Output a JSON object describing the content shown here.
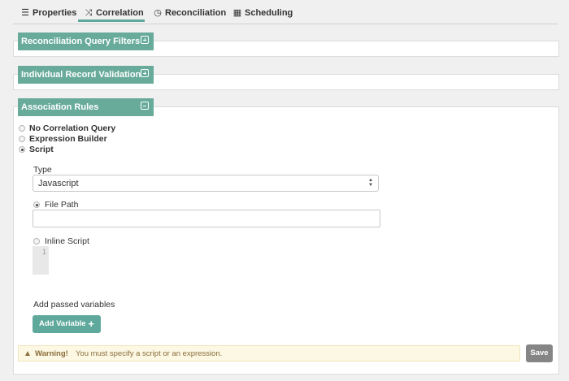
{
  "tabs": [
    {
      "label": "Properties",
      "icon": "list-icon",
      "glyph": "☰",
      "active": false
    },
    {
      "label": "Correlation",
      "icon": "shuffle-icon",
      "glyph": "⤨",
      "active": true
    },
    {
      "label": "Reconciliation",
      "icon": "clock-icon",
      "glyph": "◷",
      "active": false
    },
    {
      "label": "Scheduling",
      "icon": "calendar-icon",
      "glyph": "▦",
      "active": false
    }
  ],
  "sections": {
    "query_filters": {
      "title": "Reconciliation Query Filters",
      "expanded": false
    },
    "record_validation": {
      "title": "Individual Record Validation",
      "expanded": false
    },
    "association_rules": {
      "title": "Association Rules",
      "expanded": true
    }
  },
  "correlation_options": [
    {
      "label": "No Correlation Query",
      "selected": false
    },
    {
      "label": "Expression Builder",
      "selected": false
    },
    {
      "label": "Script",
      "selected": true
    }
  ],
  "script": {
    "type_label": "Type",
    "type_value": "Javascript",
    "file_path_label": "File Path",
    "file_path_value": "",
    "file_path_selected": true,
    "inline_label": "Inline Script",
    "inline_selected": false,
    "editor_line": "1"
  },
  "variables": {
    "label": "Add passed variables",
    "add_button": "Add Variable"
  },
  "warning": {
    "title": "Warning!",
    "message": "You must specify a script or an expression."
  },
  "save_button": "Save",
  "colors": {
    "accent": "#68ab9b",
    "warning_bg": "#fcf8e3",
    "save_bg": "#858585"
  }
}
